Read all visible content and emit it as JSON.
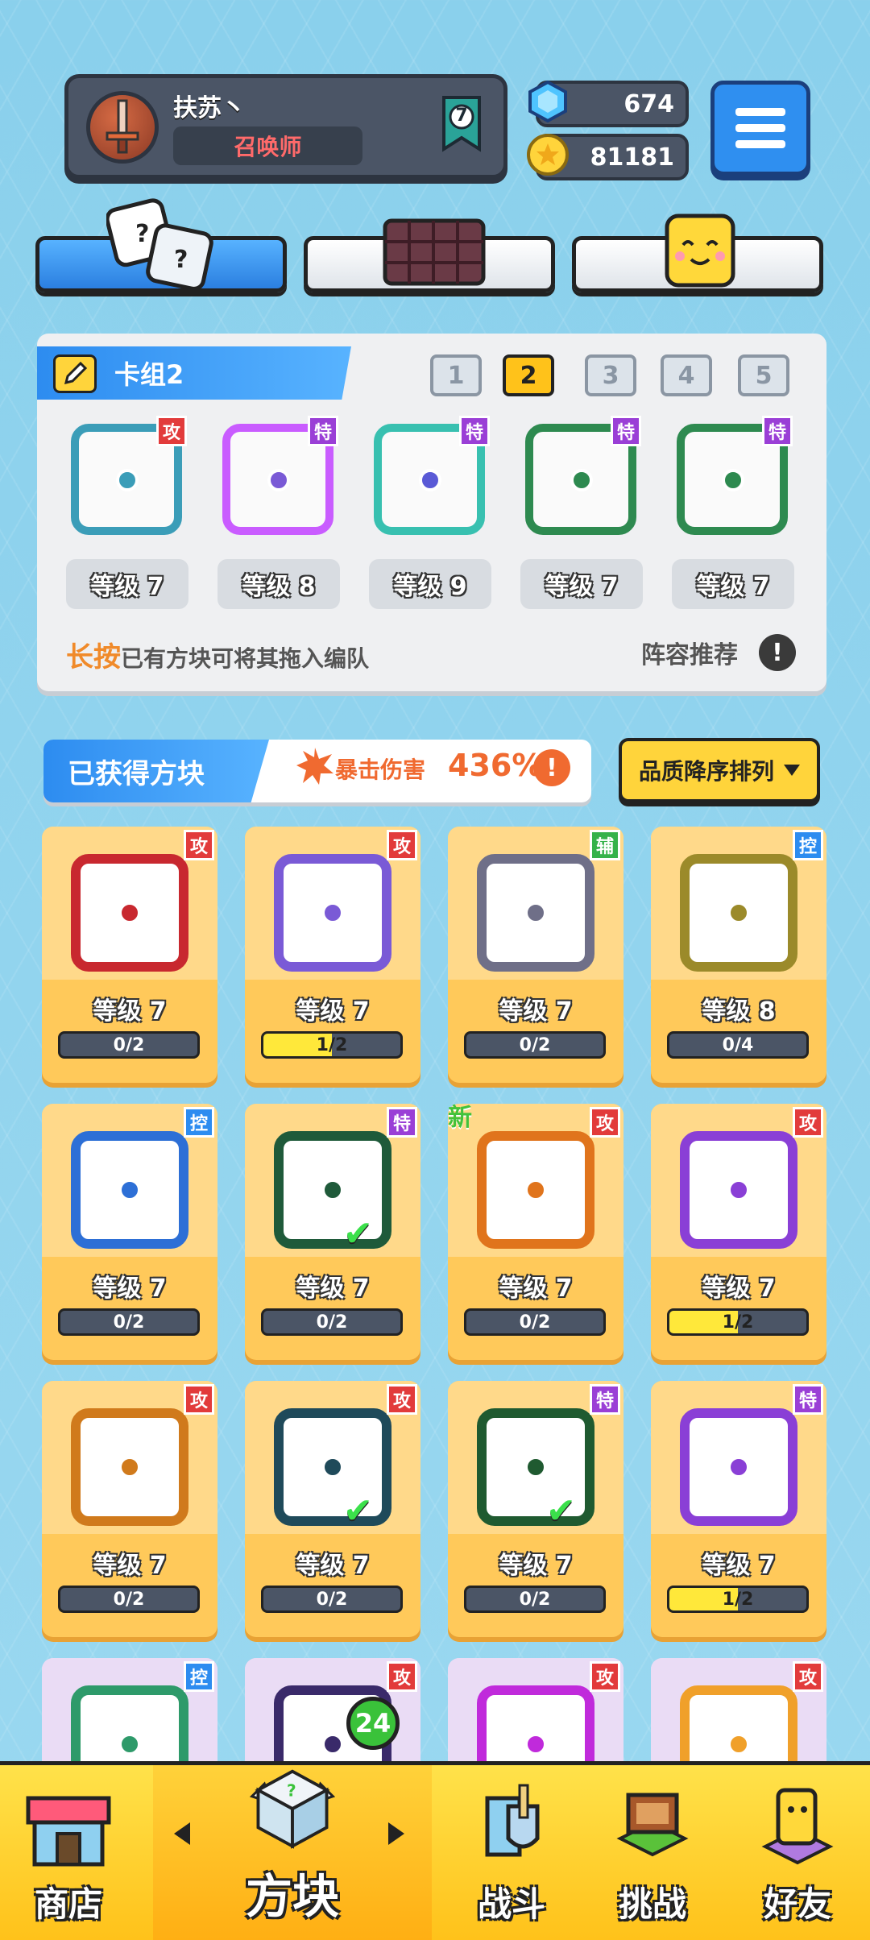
{
  "profile": {
    "name": "扶苏丶",
    "title": "召唤师",
    "rank": "7"
  },
  "resources": {
    "gems": "674",
    "coins": "81181"
  },
  "deck": {
    "title": "卡组2",
    "slots": [
      "1",
      "2",
      "3",
      "4",
      "5"
    ],
    "active_slot": "2",
    "blocks": [
      {
        "level": "等级 7",
        "tag": "攻",
        "color": "#3b9db8"
      },
      {
        "level": "等级 8",
        "tag": "特",
        "color": "#c95cff"
      },
      {
        "level": "等级 9",
        "tag": "特",
        "color": "#38c0b0"
      },
      {
        "level": "等级 7",
        "tag": "特",
        "color": "#2e8a50"
      },
      {
        "level": "等级 7",
        "tag": "特",
        "color": "#2e8a50"
      }
    ],
    "hint_bold": "长按",
    "hint_rest": "已有方块可将其拖入编队",
    "recommend": "阵容推荐",
    "info": "!"
  },
  "owned": {
    "label": "已获得方块",
    "crit_label": "暴击伤害",
    "crit_value": "436%",
    "sort_label": "品质降序排列",
    "cards": [
      {
        "level": "等级 7",
        "progress": "0/2",
        "tag": "攻",
        "tag_type": "attack",
        "color": "#c8282f",
        "half": false,
        "check": false,
        "new": false
      },
      {
        "level": "等级 7",
        "progress": "1/2",
        "tag": "攻",
        "tag_type": "attack",
        "color": "#7a5ad6",
        "half": true,
        "check": false,
        "new": false
      },
      {
        "level": "等级 7",
        "progress": "0/2",
        "tag": "辅",
        "tag_type": "support",
        "color": "#6f6f88",
        "half": false,
        "check": false,
        "new": false
      },
      {
        "level": "等级 8",
        "progress": "0/4",
        "tag": "控",
        "tag_type": "control",
        "color": "#9b8a2a",
        "half": false,
        "check": false,
        "new": false
      },
      {
        "level": "等级 7",
        "progress": "0/2",
        "tag": "控",
        "tag_type": "control",
        "color": "#2d6fd6",
        "half": false,
        "check": false,
        "new": false
      },
      {
        "level": "等级 7",
        "progress": "0/2",
        "tag": "特",
        "tag_type": "special",
        "color": "#1f5a3a",
        "half": false,
        "check": true,
        "new": false
      },
      {
        "level": "等级 7",
        "progress": "0/2",
        "tag": "攻",
        "tag_type": "attack",
        "color": "#e0741c",
        "half": false,
        "check": false,
        "new": true
      },
      {
        "level": "等级 7",
        "progress": "1/2",
        "tag": "攻",
        "tag_type": "attack",
        "color": "#8a3fd6",
        "half": true,
        "check": false,
        "new": false
      },
      {
        "level": "等级 7",
        "progress": "0/2",
        "tag": "攻",
        "tag_type": "attack",
        "color": "#d07a1c",
        "half": false,
        "check": false,
        "new": false
      },
      {
        "level": "等级 7",
        "progress": "0/2",
        "tag": "攻",
        "tag_type": "attack",
        "color": "#1f4a5a",
        "half": false,
        "check": true,
        "new": false
      },
      {
        "level": "等级 7",
        "progress": "0/2",
        "tag": "特",
        "tag_type": "special",
        "color": "#1f5a30",
        "half": false,
        "check": true,
        "new": false
      },
      {
        "level": "等级 7",
        "progress": "1/2",
        "tag": "特",
        "tag_type": "special",
        "color": "#8a3fd6",
        "half": true,
        "check": false,
        "new": false
      },
      {
        "level": "",
        "progress": "",
        "tag": "控",
        "tag_type": "control",
        "color": "#2e9a6a",
        "half": false,
        "check": false,
        "new": false
      },
      {
        "level": "",
        "progress": "",
        "tag": "攻",
        "tag_type": "attack",
        "color": "#3a2a6a",
        "half": false,
        "check": false,
        "new": false
      },
      {
        "level": "",
        "progress": "",
        "tag": "攻",
        "tag_type": "attack",
        "color": "#c02adb",
        "half": false,
        "check": false,
        "new": false
      },
      {
        "level": "",
        "progress": "",
        "tag": "攻",
        "tag_type": "attack",
        "color": "#f0a02a",
        "half": false,
        "check": false,
        "new": false
      }
    ],
    "new_label": "新"
  },
  "nav": {
    "shop": "商店",
    "blocks": "方块",
    "battle": "战斗",
    "challenge": "挑战",
    "friends": "好友",
    "blocks_badge": "24"
  }
}
